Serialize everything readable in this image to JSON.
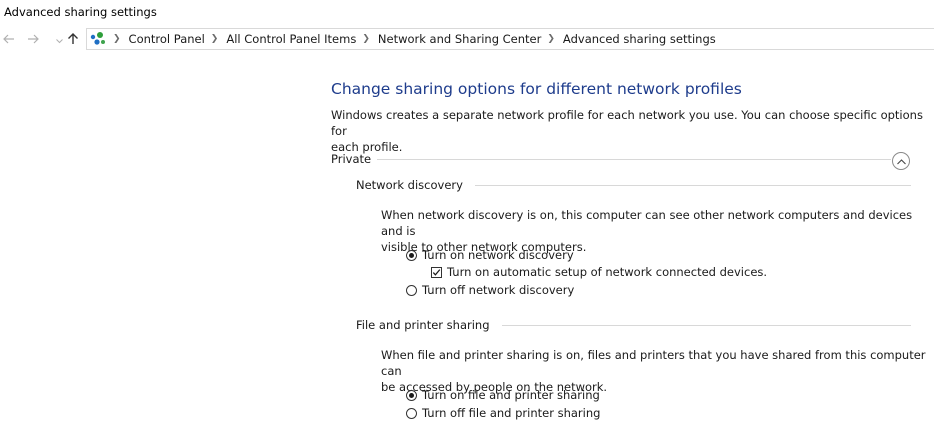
{
  "window": {
    "title": "Advanced sharing settings"
  },
  "nav": {
    "back_icon": "arrow-left-icon",
    "forward_icon": "arrow-right-icon",
    "up_icon": "arrow-up-icon"
  },
  "breadcrumb": [
    {
      "label": "Control Panel"
    },
    {
      "label": "All Control Panel Items"
    },
    {
      "label": "Network and Sharing Center"
    },
    {
      "label": "Advanced sharing settings"
    }
  ],
  "main": {
    "heading": "Change sharing options for different network profiles",
    "description_line1": "Windows creates a separate network profile for each network you use. You can choose specific options for",
    "description_line2": "each profile.",
    "profile": {
      "name": "Private",
      "collapse_icon": "chevron-up-icon",
      "network_discovery": {
        "title": "Network discovery",
        "desc_line1": "When network discovery is on, this computer can see other network computers and devices and is",
        "desc_line2": "visible to other network computers.",
        "option_on": "Turn on network discovery",
        "option_on_selected": true,
        "auto_setup": "Turn on automatic setup of network connected devices.",
        "auto_setup_checked": true,
        "option_off": "Turn off network discovery",
        "option_off_selected": false
      },
      "file_printer_sharing": {
        "title": "File and printer sharing",
        "desc_line1": "When file and printer sharing is on, files and printers that you have shared from this computer can",
        "desc_line2": "be accessed by people on the network.",
        "option_on": "Turn on file and printer sharing",
        "option_on_selected": true,
        "option_off": "Turn off file and printer sharing",
        "option_off_selected": false
      }
    }
  }
}
